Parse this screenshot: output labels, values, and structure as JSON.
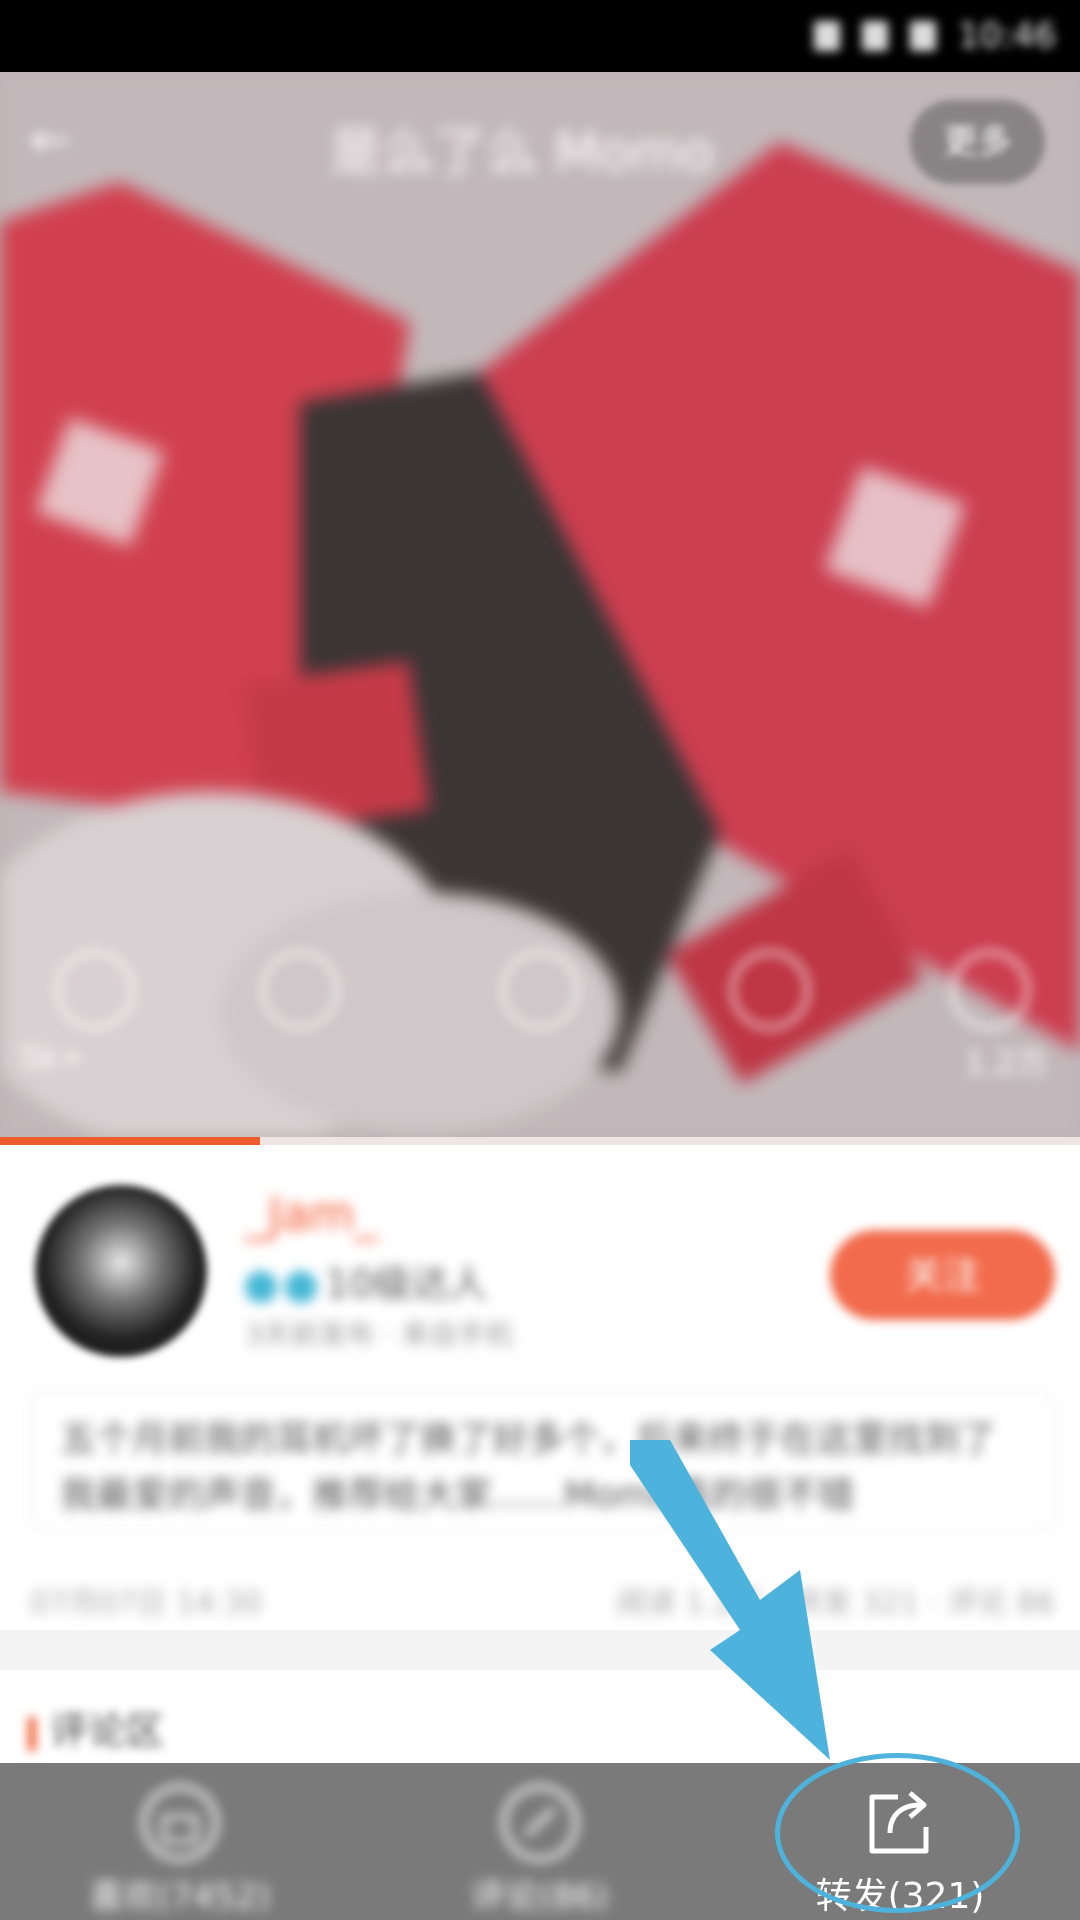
{
  "status_bar": {
    "time": "10:46"
  },
  "nav": {
    "title": "是么了么 Momo",
    "more_label": "更多"
  },
  "photo_overlay": {
    "left_count": "5k+",
    "right_count": "1.2万"
  },
  "author": {
    "name": "_Jam_",
    "level_text": "10级达人",
    "meta_text": "3天前发布 · 来自手机",
    "follow_label": "关注"
  },
  "post": {
    "text": "五个月前我的耳机坏了换了好多个，后来终于在这里找到了我最爱的声音，推荐给大家……Momo真的很不错",
    "date": "07月07日 14:30",
    "stats": "阅读 1.2万 · 转发 321 · 评论 86"
  },
  "section": {
    "title": "评论区"
  },
  "bottom_bar": {
    "like_label": "喜欢(7452)",
    "comment_label": "评论(86)",
    "share_label": "转发(321)"
  },
  "colors": {
    "accent": "#f05a2f",
    "highlight": "#4eb3dc",
    "bottom_bar": "#7a7a7a"
  }
}
